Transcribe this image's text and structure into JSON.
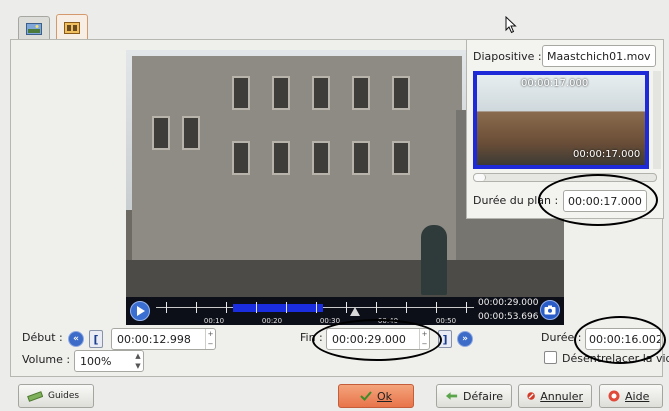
{
  "tabs": [
    {
      "name": "image-tab",
      "icon": "image-icon"
    },
    {
      "name": "video-tab",
      "icon": "video-clip-icon",
      "active": true
    }
  ],
  "player": {
    "timeline_labels": [
      "00:10",
      "00:20",
      "00:30",
      "00:40",
      "00:50"
    ],
    "current_time": "00:00:29.000",
    "total_time": "00:00:53.696"
  },
  "editor": {
    "debut_label": "Début :",
    "debut_value": "00:00:12.998",
    "fin_label": "Fin :",
    "fin_value": "00:00:29.000",
    "duree_label": "Durée :",
    "duree_value": "00:00:16.002",
    "volume_label": "Volume :",
    "volume_value": "100%",
    "desentrelacer_label": "Désentrelacer la vidéo"
  },
  "popup": {
    "diapositive_label": "Diapositive :",
    "diapositive_value": "Maastchich01.mov",
    "thumb_time_start": "00:00:17.000",
    "thumb_time_end": "00:00:17.000",
    "duree_plan_label": "Durée du plan :",
    "duree_plan_value": "00:00:17.000"
  },
  "buttons": {
    "guides": "Guides",
    "ok": "Ok",
    "defaire": "Défaire",
    "annuler": "Annuler",
    "aide": "Aide"
  },
  "colors": {
    "accent": "#1a2ee0",
    "ok_button": "#e8744a"
  }
}
